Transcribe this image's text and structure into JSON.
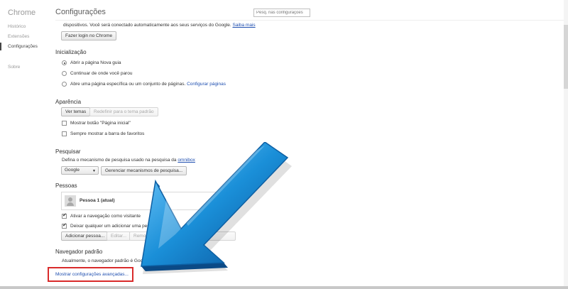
{
  "sidebar": {
    "brand": "Chrome",
    "items": [
      {
        "label": "Histórico"
      },
      {
        "label": "Extensões"
      },
      {
        "label": "Configurações"
      },
      {
        "label": "Sobre"
      }
    ]
  },
  "header": {
    "title": "Configurações",
    "search_placeholder": "Pesq. nas configurações"
  },
  "signin": {
    "text": "dispositivos. Você será conectado automaticamente aos seus serviços do Google.",
    "learn_more": "Saiba mais",
    "button": "Fazer login no Chrome"
  },
  "startup": {
    "title": "Inicialização",
    "options": [
      {
        "label": "Abrir a página Nova guia",
        "checked": true
      },
      {
        "label": "Continuar de onde você parou",
        "checked": false
      },
      {
        "label": "Abre uma página específica ou um conjunto de páginas.",
        "checked": false
      }
    ],
    "configure_link": "Configurar páginas"
  },
  "appearance": {
    "title": "Aparência",
    "themes_button": "Ver temas",
    "reset_button": "Redefinir para o tema padrão",
    "show_home": "Mostrar botão \"Página inicial\"",
    "show_bookmarks": "Sempre mostrar a barra de favoritos"
  },
  "search": {
    "title": "Pesquisar",
    "description": "Defina o mecanismo de pesquisa usado na pesquisa da",
    "omnibox_link": "omnibox",
    "engine": "Google",
    "manage_button": "Gerenciar mecanismos de pesquisa..."
  },
  "people": {
    "title": "Pessoas",
    "profile": "Pessoa 1 (atual)",
    "guest": "Ativar a navegação como visitante",
    "add_anyone": "Deixar qualquer um adicionar uma pesso",
    "add_button": "Adicionar pessoa...",
    "edit_button": "Editar...",
    "remove_button": "Remo"
  },
  "default_browser": {
    "title": "Navegador padrão",
    "status": "Atualmente, o navegador padrão é Goo"
  },
  "advanced_link": "Mostrar configurações avançadas...",
  "colors": {
    "highlight": "#d92b2b",
    "link": "#1f4fb0",
    "arrow": "#1a8fd8"
  }
}
